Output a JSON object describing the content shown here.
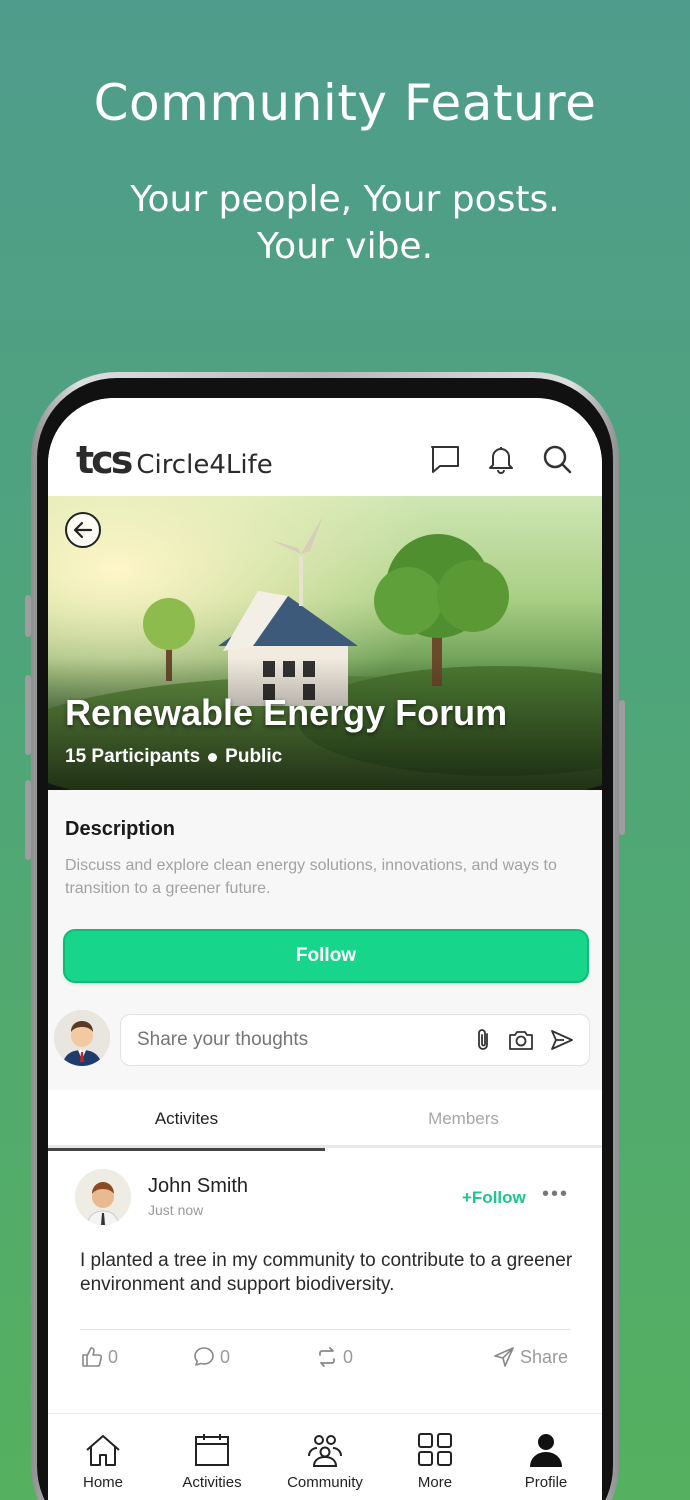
{
  "promo": {
    "title": "Community Feature",
    "subtitle_line1": "Your people, Your posts.",
    "subtitle_line2": "Your vibe."
  },
  "header": {
    "logo_mark": "tcs",
    "logo_name": "Circle4Life",
    "icons": [
      "chat-icon",
      "bell-icon",
      "search-icon"
    ]
  },
  "banner": {
    "title": "Renewable Energy Forum",
    "participants": "15 Participants",
    "visibility": "Public"
  },
  "description": {
    "heading": "Description",
    "text": "Discuss and explore clean energy solutions, innovations, and ways to transition to a greener future."
  },
  "follow_button": "Follow",
  "composer": {
    "placeholder": "Share your thoughts",
    "icons": [
      "attach-icon",
      "camera-icon",
      "send-icon"
    ]
  },
  "tabs": [
    {
      "label": "Activites",
      "active": true
    },
    {
      "label": "Members",
      "active": false
    }
  ],
  "post": {
    "author": "John Smith",
    "time": "Just now",
    "follow_label": "+Follow",
    "more": "•••",
    "text": "I planted a tree in my community to contribute to a greener environment and support biodiversity.",
    "likes": "0",
    "comments": "0",
    "reposts": "0",
    "share_label": "Share"
  },
  "bottom_nav": [
    {
      "label": "Home",
      "icon": "home-icon"
    },
    {
      "label": "Activities",
      "icon": "calendar-icon"
    },
    {
      "label": "Community",
      "icon": "community-icon"
    },
    {
      "label": "More",
      "icon": "grid-icon"
    },
    {
      "label": "Profile",
      "icon": "person-icon"
    }
  ],
  "colors": {
    "accent": "#18d58c",
    "follow_text": "#18c98a",
    "background_top": "#4f9c8c",
    "background_bottom": "#55b05f"
  }
}
